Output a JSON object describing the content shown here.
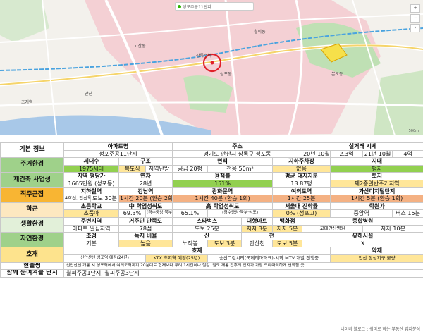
{
  "map": {
    "search_hint": "성포주공11단지",
    "right_controls": [
      "+",
      "−",
      "⌖"
    ],
    "labels": [
      "상록수역",
      "안산",
      "성포동",
      "월피동",
      "본오동",
      "초지역",
      "고잔동"
    ],
    "scale": "500m",
    "colors": {
      "highlight_zone": "#f2b8c3",
      "marker": "#e0202a",
      "park": "#b9dcb0",
      "water": "#a8c8e8",
      "road": "#ffffff"
    }
  },
  "rows": {
    "basic": {
      "category": "기본 정보",
      "headers": [
        "아파트명",
        "주소",
        "실거래 시세"
      ],
      "values": [
        "성포주공11단지",
        "경기도 안산시 상록구 성포동",
        "20년 10월",
        "2.3억",
        "21년 10월",
        "4억"
      ]
    },
    "living": {
      "category": "주거환경",
      "headers": [
        "세대수",
        "구조",
        "면적",
        "지하주차장",
        "지대"
      ],
      "values": [
        "1975세대",
        "복도식",
        "지역난방",
        "공급 20평",
        "전용 50m²",
        "없음",
        "평지"
      ]
    },
    "rebuild": {
      "category": "재건축 사업성",
      "headers": [
        "지역 평당가",
        "연차",
        "용적률",
        "평균 대지지분",
        "토지"
      ],
      "values": [
        "1665만원 (성포동)",
        "28년",
        "151%",
        "13.87평",
        "제2종일반주거지역"
      ]
    },
    "commute": {
      "category": "직주근접",
      "headers": [
        "지하철역",
        "강남역",
        "광화문역",
        "여의도역",
        "가산디지털단지"
      ],
      "values": [
        "4호선, 안산역",
        "도보 30분",
        "1시간 20분 (환승 2회)",
        "1시간 40분 (환승 1회)",
        "1시간 25분",
        "1시간 5분 (환승 1회)"
      ]
    },
    "school": {
      "category": "학군",
      "headers": [
        "초등학교",
        "中 학업성취도",
        "高 학업성취도",
        "서울대 진학률",
        "학원가"
      ],
      "values": [
        "초품아",
        "69.3%",
        "(경수중앙·북부·성포)",
        "65.1%",
        "(경수중앙·북부·성포)",
        "0% (성포고)",
        "중앙역",
        "버스 15분"
      ]
    },
    "life": {
      "category": "생활환경",
      "headers": [
        "주변지역",
        "거주민 만족도",
        "스타벅스",
        "대형마트",
        "백화점",
        "종합병원"
      ],
      "values": [
        "아파트 밀집지역",
        "78점",
        "도보 25분",
        "자차 3분",
        "자차 5분",
        "고대안산병원",
        "자차 10분"
      ]
    },
    "nature": {
      "category": "자연환경",
      "headers": [
        "조경",
        "녹지 비율",
        "산",
        "천",
        "유해시설"
      ],
      "values": [
        "기본",
        "높음",
        "노적봉",
        "도보 3분",
        "안산천",
        "도보 5분",
        "X"
      ]
    },
    "factor": {
      "category": "호재",
      "headers": [
        "호재",
        "악재"
      ],
      "values": [
        "신안산선 성포역 예정(24년)",
        "KTX 초지역 예정(25년)",
        "송산그린시티(국제테마파크)-시화 MTV 개발 진행중",
        "안산 장상지구 물량"
      ]
    },
    "review": {
      "category": "한줄평",
      "text": "신안산선 개통 시 성포역에서 여의도역까지 20분대로 현재보다 무려 1시간이나 절감. 철도 개통 전후의 입지가 가장 드라마틱하게 변화할 곳"
    },
    "together": {
      "category": "함께 눈여겨볼 단지",
      "text": "월피주공1단지, 월피주공3단지"
    }
  },
  "footer": "네이버 블로그 : 쉬미로 하는 부동산 입지분석"
}
